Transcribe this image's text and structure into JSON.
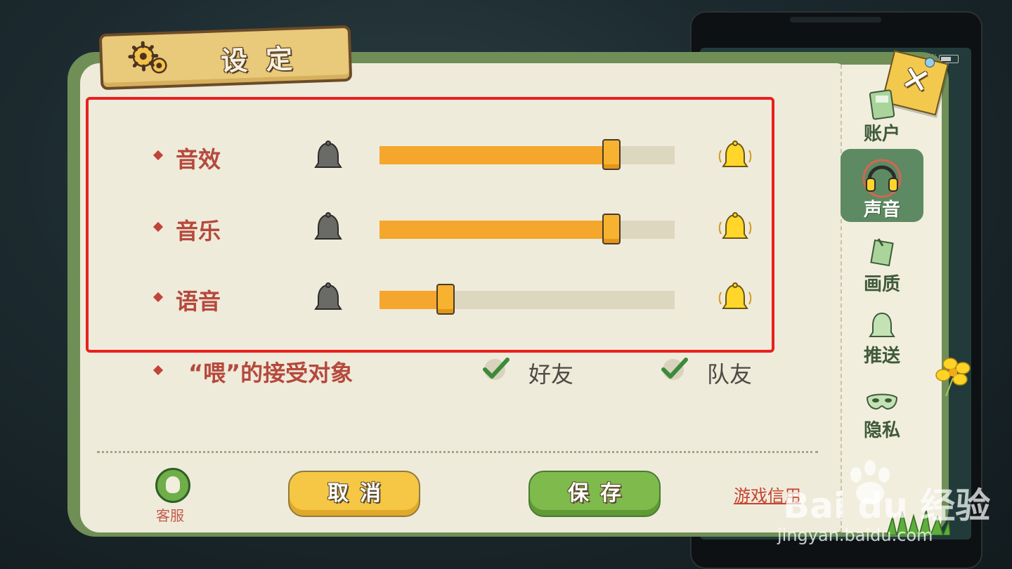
{
  "title": "设定",
  "sliders": [
    {
      "label": "音效",
      "value": 0.78
    },
    {
      "label": "音乐",
      "value": 0.78
    },
    {
      "label": "语音",
      "value": 0.22
    }
  ],
  "feed": {
    "label": "“喂”的接受对象",
    "options": [
      {
        "label": "好友",
        "checked": true
      },
      {
        "label": "队友",
        "checked": true
      }
    ]
  },
  "footer": {
    "service_label": "客服",
    "cancel_label": "取消",
    "save_label": "保存",
    "credit_link": "游戏信用"
  },
  "tabs": [
    {
      "label": "账户",
      "icon": "account-card-icon",
      "active": false
    },
    {
      "label": "声音",
      "icon": "headphones-icon",
      "active": true
    },
    {
      "label": "画质",
      "icon": "picture-icon",
      "active": false
    },
    {
      "label": "推送",
      "icon": "bell-icon",
      "active": false
    },
    {
      "label": "隐私",
      "icon": "mask-icon",
      "active": false
    }
  ],
  "close_icon": "close-x-icon",
  "watermark": {
    "logo": "Bai du 经验",
    "url": "jingyan.baidu.com"
  },
  "status": {
    "battery": "%"
  },
  "colors": {
    "accent_orange": "#f4a72c",
    "label_red": "#b5493c",
    "frame_green": "#6f8f57",
    "highlight_box": "#e8201e"
  }
}
